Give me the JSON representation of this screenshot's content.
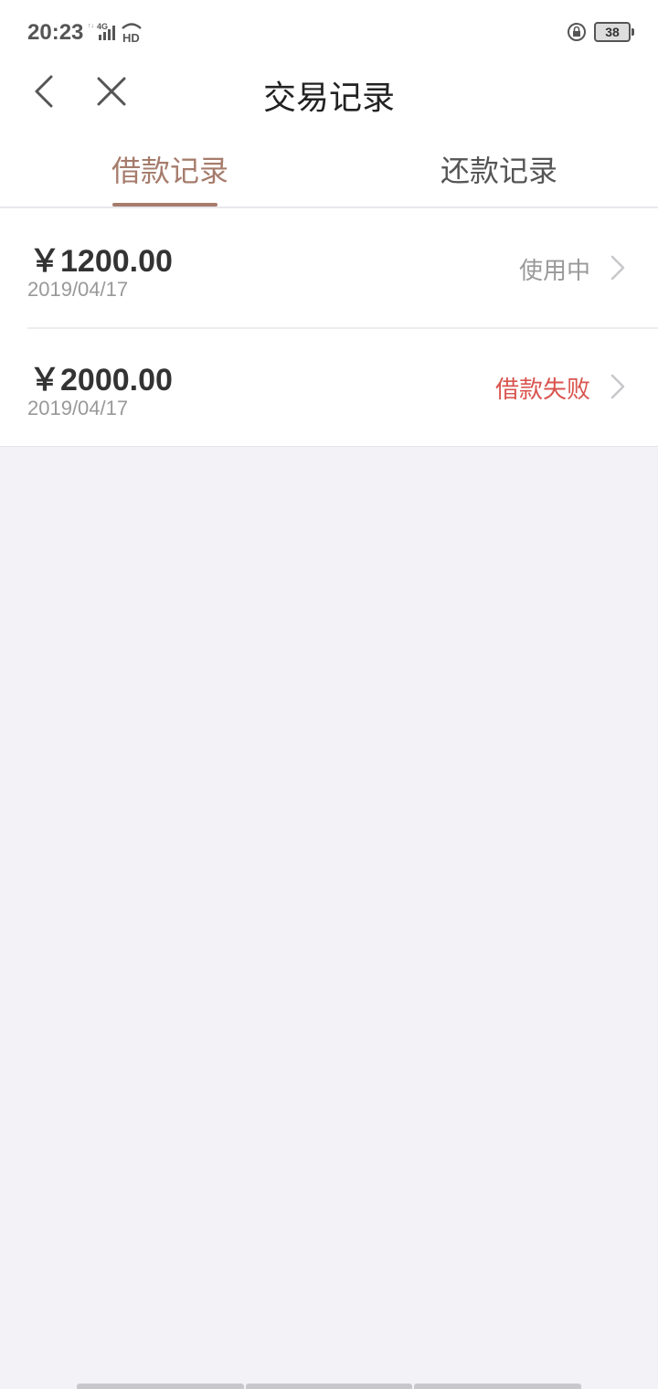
{
  "status_bar": {
    "time": "20:23",
    "network": "4G",
    "hd": "HD",
    "battery": "38"
  },
  "header": {
    "title": "交易记录"
  },
  "tabs": [
    {
      "label": "借款记录",
      "active": true
    },
    {
      "label": "还款记录",
      "active": false
    }
  ],
  "records": [
    {
      "amount": "￥1200.00",
      "date": "2019/04/17",
      "status": "使用中",
      "status_color": "#999999"
    },
    {
      "amount": "￥2000.00",
      "date": "2019/04/17",
      "status": "借款失败",
      "status_color": "#d9544f"
    }
  ],
  "colors": {
    "accent": "#a67c6c",
    "error": "#d9544f",
    "background": "#f2f2f7"
  }
}
